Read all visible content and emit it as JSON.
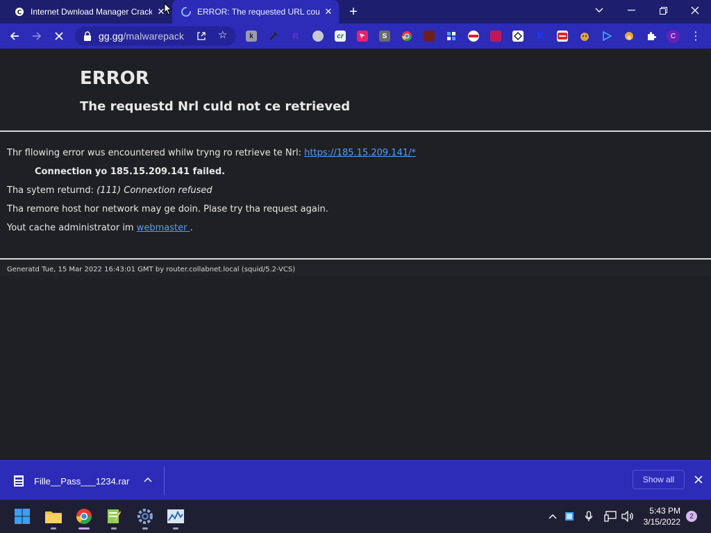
{
  "browser": {
    "tabs": [
      {
        "title": "Internet Dwnload Manager Crack",
        "active": false
      },
      {
        "title": "ERROR: The requested URL could",
        "active": true
      }
    ],
    "new_tab": "+",
    "omnibox": {
      "domain": "gg.gg",
      "path": "/malwarepack"
    },
    "profile_initial": "C",
    "extensions": [
      "k",
      "e",
      "R",
      "w",
      "cr",
      "p",
      "S",
      "c",
      "m",
      "g",
      "o",
      "t",
      "d",
      "R",
      "t",
      "u",
      "a"
    ]
  },
  "page": {
    "heading": "ERROR",
    "subheading": "The requestd Nrl culd not ce retrieved",
    "line1_text": "Thr fllowing error wus encountered whilw tryng ro retrieve te Nrl: ",
    "line1_link": "https://185.15.209.141/*",
    "line2": "Connection yo 185.15.209.141 failed.",
    "line3_prefix": "Tha sytem returnd: ",
    "line3_italic": "(111) Connextion refused",
    "line4": "Tha remore host hor network may ge doin. Plase try tha request again.",
    "line5_prefix": "Yout cache administrator im ",
    "line5_link": "webmaster ",
    "line5_suffix": ".",
    "footer": "Generatd Tue, 15 Mar 2022 16:43:01 GMT by router.collabnet.local (squid/5.2-VCS)"
  },
  "download_bar": {
    "file_name": "Fille__Pass___1234.rar",
    "show_all": "Show all"
  },
  "taskbar": {
    "time": "5:43 PM",
    "date": "3/15/2022",
    "notifications": "2"
  },
  "colors": {
    "tabstrip": "#1e1e6e",
    "toolbar": "#2c2cb8",
    "page_bg": "#1f2023",
    "link": "#5a9bff",
    "taskbar": "#1f1f33"
  }
}
